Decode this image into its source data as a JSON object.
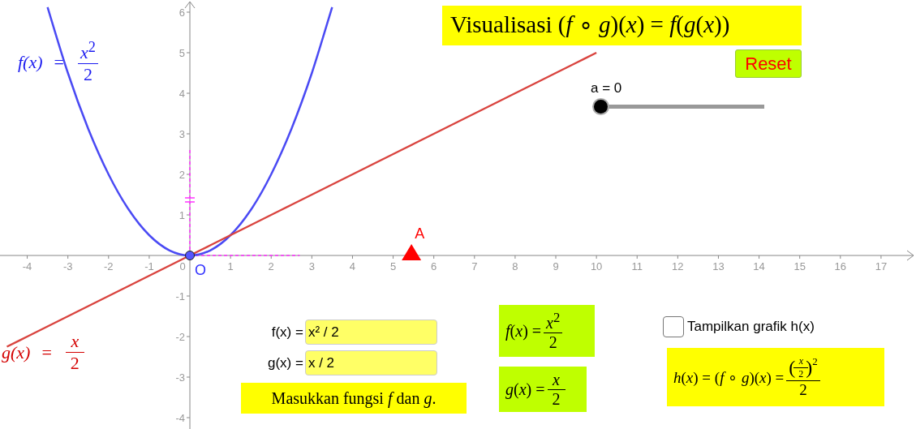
{
  "title": "Visualisasi (*f* ∘ *g*)(*x*) = *f*(*g*(*x*))",
  "reset_button": "Reset",
  "slider": {
    "label": "a = 0",
    "level": 0
  },
  "graph": {
    "chart_data": {
      "type": "line",
      "x": [
        -4.5,
        -4,
        -3.5,
        -3,
        -2.5,
        -2,
        -1.5,
        -1,
        -0.5,
        0,
        0.5,
        1,
        1.5,
        2,
        2.5,
        3,
        3.5,
        4,
        4.5,
        5,
        5.5,
        6,
        6.5,
        7,
        7.5,
        8,
        8.5,
        9,
        9.5,
        10
      ],
      "series": [
        {
          "name": "f(x)",
          "color": "#4a4af4",
          "values": [
            null,
            null,
            6.125,
            4.5,
            3.125,
            2,
            1.125,
            0.5,
            0.125,
            0,
            0.125,
            0.5,
            1.125,
            2,
            3.125,
            4.5,
            6.125,
            null,
            null,
            null,
            null,
            null,
            null,
            null,
            null,
            null,
            null,
            null,
            null,
            null
          ]
        },
        {
          "name": "g(x)",
          "color": "#d9443f",
          "values": [
            -2.25,
            -2,
            -1.75,
            -1.5,
            -1.25,
            -1,
            -0.75,
            -0.5,
            -0.25,
            0,
            0.25,
            0.5,
            0.75,
            1,
            1.25,
            1.5,
            1.75,
            2,
            2.25,
            2.5,
            2.75,
            3,
            3.25,
            3.5,
            3.75,
            4,
            4.25,
            4.5,
            4.75,
            5
          ]
        }
      ],
      "xticks": [
        -4,
        -3,
        -2,
        -1,
        1,
        2,
        3,
        4,
        5,
        6,
        7,
        8,
        9,
        10,
        11,
        12,
        13,
        14,
        15,
        16,
        17
      ],
      "yticks": [
        -4,
        -3,
        -2,
        -1,
        1,
        2,
        3,
        4,
        5,
        6
      ],
      "xlim": [
        -4.67,
        17.8
      ],
      "ylim": [
        -4.28,
        6.26
      ]
    },
    "origin_tick": "0",
    "origin_label": "O",
    "point": {
      "label": "A"
    }
  },
  "curve_labels": [
    {
      "eq": "=",
      "numerator": "*x*$^{2}$",
      "denominator": "2",
      "color": "#1c1cf0"
    },
    {
      "eq": "=",
      "numerator": "*x*",
      "denominator": "2",
      "color": "#d40000"
    }
  ],
  "inputs": [
    {
      "label": "f(x) =",
      "value": "x² / 2"
    },
    {
      "label": "g(x) =",
      "value": "x / 2"
    }
  ],
  "hint": "Masukkan fungsi *f* dan *g*.",
  "formulas": [
    {
      "lhs": "*f*(*x*) =",
      "numerator": "*x*$^{2}$",
      "denominator": "2"
    },
    {
      "lhs": "*g*(*x*) =",
      "numerator": "*x*",
      "denominator": "2"
    }
  ],
  "checkbox": {
    "label": "Tampilkan grafik h(x)",
    "checked": false
  },
  "h_formula": {
    "lhs": "*h*(*x*) = (*f* ∘ *g*)(*x*) =",
    "open": "(",
    "inner_numerator": "*x*",
    "inner_denominator": "2",
    "close": ")",
    "power": "2",
    "denominator": "2"
  }
}
